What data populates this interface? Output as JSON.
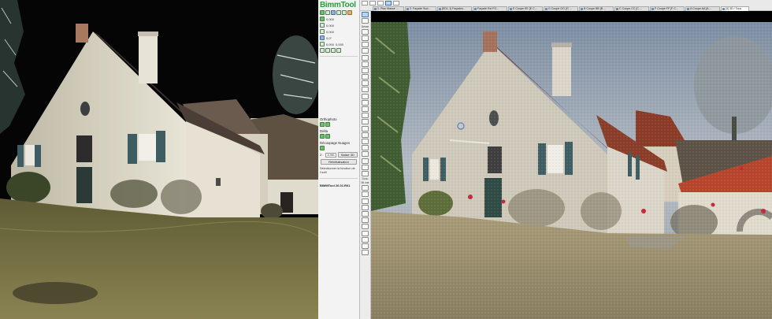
{
  "panel": {
    "logo": "BimmTool",
    "coords": [
      "0,000",
      "0,000",
      "0,000"
    ],
    "angle": "0,0°",
    "offset": [
      "0,000",
      "0,000"
    ],
    "sections": {
      "orthophoto": "Orthophoto",
      "delta": "Delta",
      "cloud_clipping": "Découpage Nuages"
    },
    "z_label": "Z :",
    "z_value": "-0,961",
    "save_3d": "Saisie 3D",
    "reset": "Réinitialisation",
    "hint": "Sélectionner la fonction de l'outil",
    "version": "BIMMTool 26.01.R01"
  },
  "toolbox": {
    "labels": [
      "Desse",
      "Docu",
      "Mi vue"
    ]
  },
  "tabs": [
    {
      "label": "1. Plan Masse ..."
    },
    {
      "label": "3. Façade Sud..."
    },
    {
      "label": "[EDL-1] Façades..."
    },
    {
      "label": "Façade Est FO..."
    },
    {
      "label": "E Coupe EE [E C..."
    },
    {
      "label": "G Coupe GG [G ..."
    },
    {
      "label": "B Coupe BB [B ..."
    },
    {
      "label": "C Coupe CC [C ..."
    },
    {
      "label": "F Coupe FF [F C..."
    },
    {
      "label": "A Coupe AA [A ..."
    },
    {
      "label": "[3] 3D / Tous"
    }
  ],
  "colors": {
    "brand_green": "#2b9a3b",
    "panel_bg": "#f3f3f3",
    "active_blue": "#b9d4f2"
  }
}
